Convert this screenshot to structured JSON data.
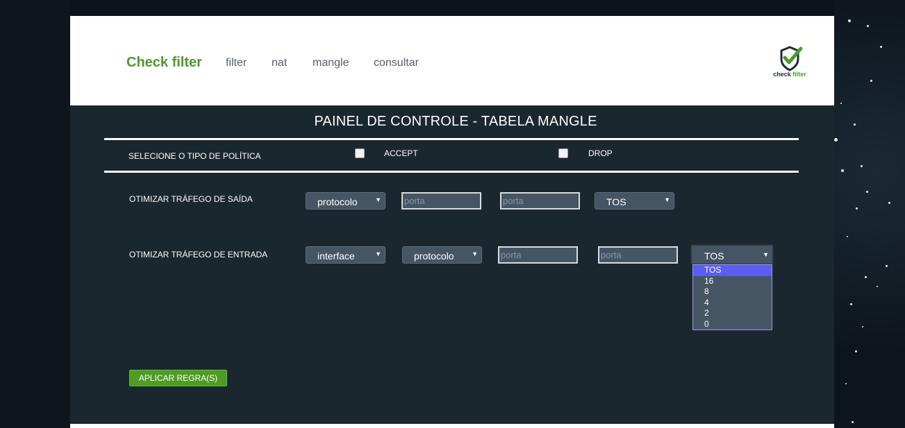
{
  "nav": {
    "brand": "Check filter",
    "links": [
      "filter",
      "nat",
      "mangle",
      "consultar"
    ],
    "logo_text_part1": "check",
    "logo_text_part2": "filter"
  },
  "panel": {
    "title": "PAINEL DE CONTROLE - TABELA MANGLE",
    "policy_label": "SELECIONE O TIPO DE POLÍTICA",
    "policy_options": [
      "ACCEPT",
      "DROP"
    ]
  },
  "outbound": {
    "label": "OTIMIZAR TRÁFEGO DE SAÍDA",
    "protocol_select": "protocolo",
    "port1_placeholder": "porta",
    "port2_placeholder": "porta",
    "tos_select": "TOS"
  },
  "inbound": {
    "label": "OTIMIZAR TRÁFEGO DE ENTRADA",
    "interface_select": "interface",
    "protocol_select": "protocolo",
    "port1_placeholder": "porta",
    "port2_placeholder": "porta",
    "tos_select": "TOS",
    "tos_options": [
      "TOS",
      "16",
      "8",
      "4",
      "2",
      "0"
    ]
  },
  "apply_button": "APLICAR REGRA(S)",
  "colors": {
    "brand_green": "#4f9a2a",
    "panel_bg": "#1b272f",
    "select_bg": "#465563",
    "dropdown_highlight": "#5c5cf0"
  }
}
